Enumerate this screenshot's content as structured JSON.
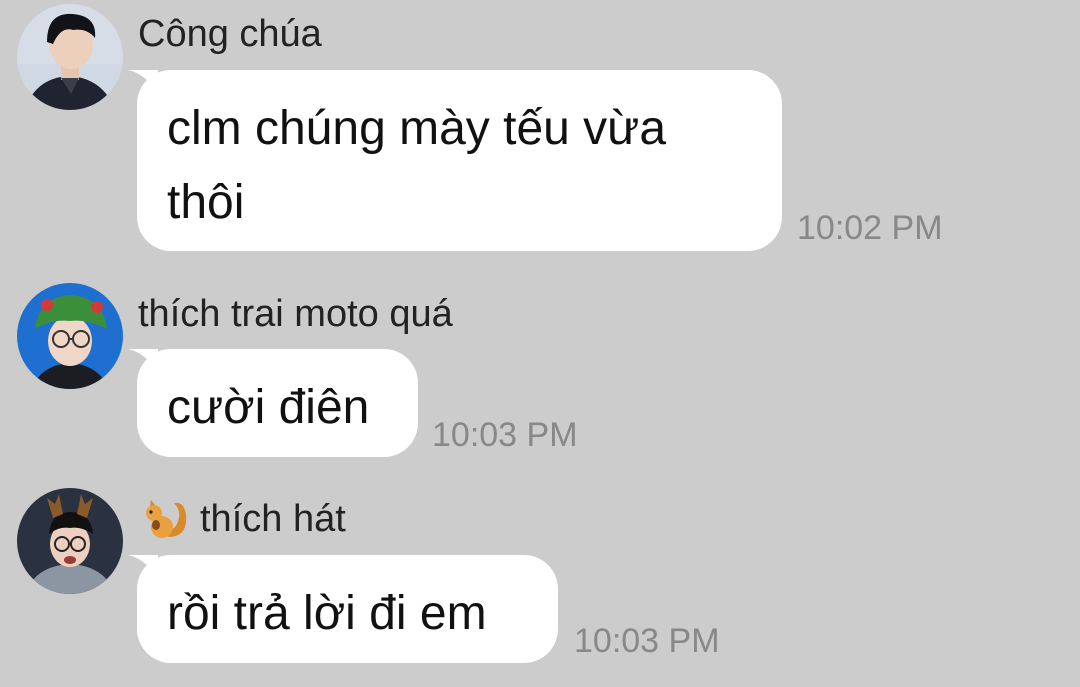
{
  "messages": [
    {
      "sender": "Công chúa",
      "text_lines": [
        "clm chúng mày tếu vừa",
        "thôi"
      ],
      "time": "10:02 PM",
      "avatar": "avatar-photo-young-man-dark-jacket"
    },
    {
      "sender": "thích trai moto quá",
      "text_lines": [
        "cười điên"
      ],
      "time": "10:03 PM",
      "avatar": "avatar-photo-boy-green-hat-glasses"
    },
    {
      "sender": "thích hát",
      "sender_emoji": "squirrel-icon",
      "text_lines": [
        "rồi trả lời đi em"
      ],
      "time": "10:03 PM",
      "avatar": "avatar-photo-boy-antlers-glasses"
    }
  ],
  "colors": {
    "background": "#cccccc",
    "bubble": "#ffffff",
    "time_text": "#888888"
  }
}
